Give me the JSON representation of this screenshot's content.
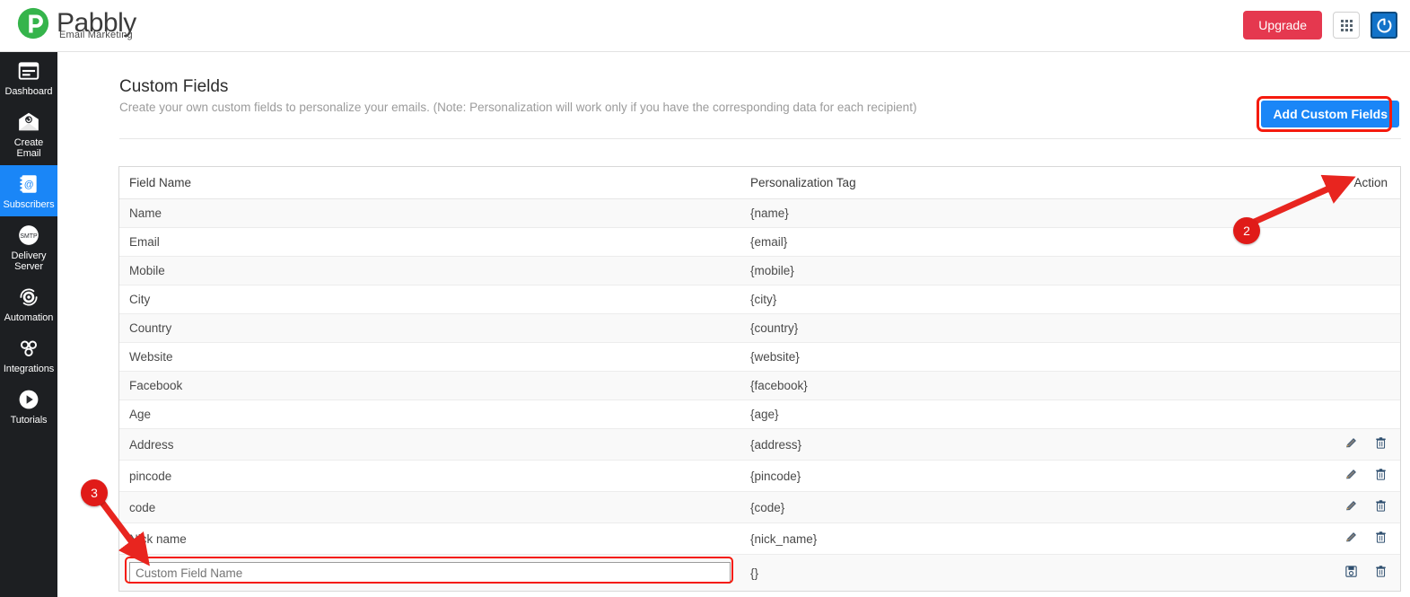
{
  "brand": {
    "name": "Pabbly",
    "tagline": "Email Marketing",
    "logo_color": "#35b44b"
  },
  "topbar": {
    "upgrade_label": "Upgrade",
    "apps_icon": "grid-apps-icon",
    "power_icon": "power-icon",
    "upgrade_color": "#e5384f",
    "power_bg": "#1273c9"
  },
  "sidebar": {
    "active_color": "#1a86f7",
    "bg_color": "#1d1f22",
    "items": [
      {
        "label": "Dashboard",
        "icon": "dashboard-icon",
        "active": false
      },
      {
        "label": "Create Email",
        "icon": "envelope-icon",
        "active": false
      },
      {
        "label": "Subscribers",
        "icon": "contacts-icon",
        "active": true
      },
      {
        "label": "Delivery Server",
        "icon": "smtp-icon",
        "active": false
      },
      {
        "label": "Automation",
        "icon": "gear-cycle-icon",
        "active": false
      },
      {
        "label": "Integrations",
        "icon": "integrations-icon",
        "active": false
      },
      {
        "label": "Tutorials",
        "icon": "play-icon",
        "active": false
      }
    ]
  },
  "page": {
    "title": "Custom Fields",
    "description": "Create your own custom fields to personalize your emails. (Note: Personalization will work only if you have the corresponding data for each recipient)",
    "add_button_label": "Add Custom Fields",
    "add_button_color": "#1a86f7"
  },
  "table": {
    "headers": {
      "field_name": "Field Name",
      "personalization_tag": "Personalization Tag",
      "action": "Action"
    },
    "rows": [
      {
        "field": "Name",
        "tag": "{name}",
        "actions": []
      },
      {
        "field": "Email",
        "tag": "{email}",
        "actions": []
      },
      {
        "field": "Mobile",
        "tag": "{mobile}",
        "actions": []
      },
      {
        "field": "City",
        "tag": "{city}",
        "actions": []
      },
      {
        "field": "Country",
        "tag": "{country}",
        "actions": []
      },
      {
        "field": "Website",
        "tag": "{website}",
        "actions": []
      },
      {
        "field": "Facebook",
        "tag": "{facebook}",
        "actions": []
      },
      {
        "field": "Age",
        "tag": "{age}",
        "actions": []
      },
      {
        "field": "Address",
        "tag": "{address}",
        "actions": [
          "edit-icon",
          "delete-icon"
        ]
      },
      {
        "field": "pincode",
        "tag": "{pincode}",
        "actions": [
          "edit-icon",
          "delete-icon"
        ]
      },
      {
        "field": "code",
        "tag": "{code}",
        "actions": [
          "edit-icon",
          "delete-icon"
        ]
      },
      {
        "field": "Nick name",
        "tag": "{nick_name}",
        "actions": [
          "edit-icon",
          "delete-icon"
        ]
      }
    ],
    "input_row": {
      "placeholder": "Custom Field Name",
      "value": "",
      "tag": "{}",
      "actions": [
        "save-icon",
        "delete-icon"
      ]
    }
  },
  "annotations": {
    "highlight_color": "#f51b0e",
    "badge_color": "#e01b18",
    "markers": [
      {
        "number": "2",
        "points_to": "add-custom-fields-button"
      },
      {
        "number": "3",
        "points_to": "custom-field-name-input"
      }
    ]
  }
}
